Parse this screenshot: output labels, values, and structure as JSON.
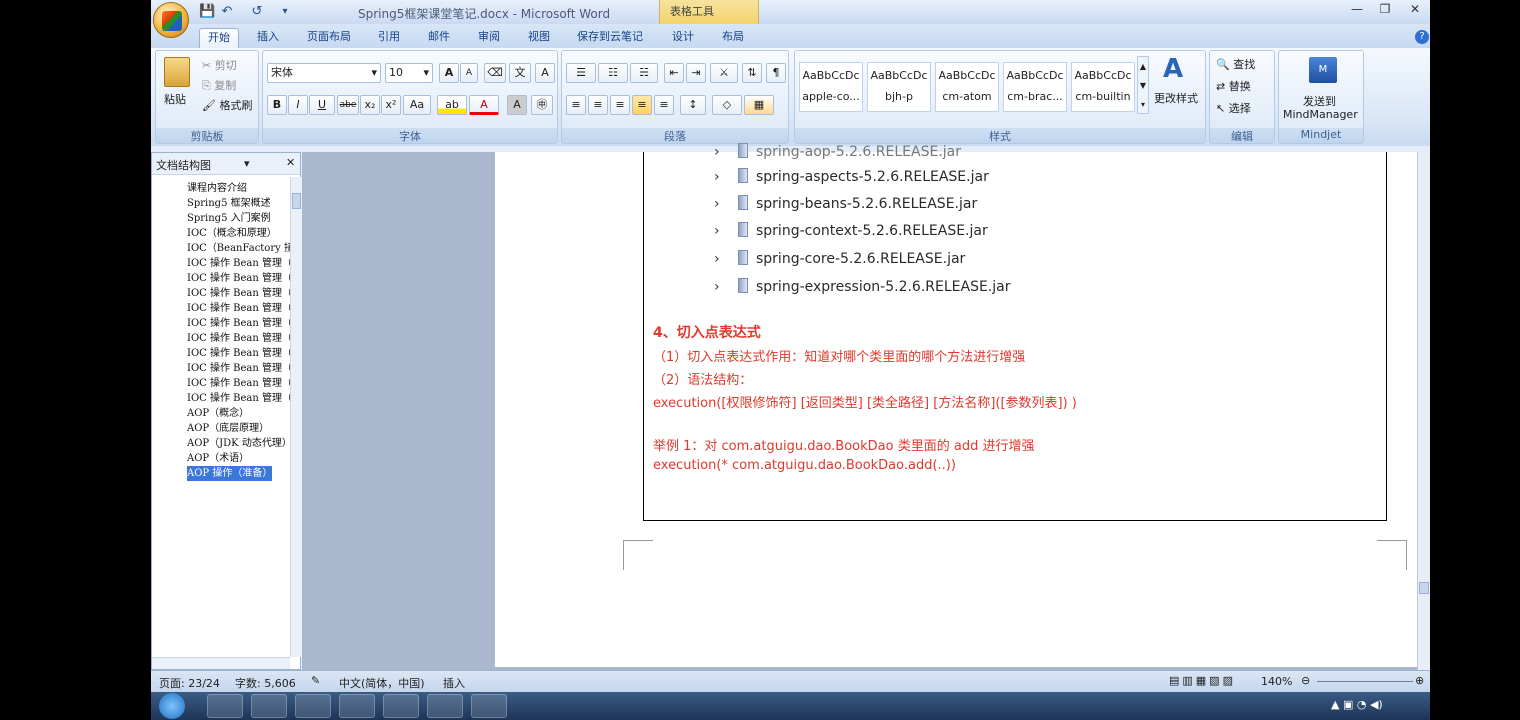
{
  "window": {
    "title": "Spring5框架课堂笔记.docx - Microsoft Word",
    "context_tab": "表格工具"
  },
  "tabs": [
    "开始",
    "插入",
    "页面布局",
    "引用",
    "邮件",
    "审阅",
    "视图",
    "保存到云笔记",
    "设计",
    "布局"
  ],
  "ribbon": {
    "clipboard": {
      "paste": "粘贴",
      "cut": "剪切",
      "copy": "复制",
      "format_painter": "格式刷",
      "label": "剪贴板"
    },
    "font": {
      "name": "宋体",
      "size": "10",
      "label": "字体"
    },
    "paragraph": {
      "label": "段落"
    },
    "styles": {
      "label": "样式",
      "items": [
        {
          "preview": "AaBbCcDc",
          "name": "apple-co..."
        },
        {
          "preview": "AaBbCcDc",
          "name": "bjh-p"
        },
        {
          "preview": "AaBbCcDc",
          "name": "cm-atom"
        },
        {
          "preview": "AaBbCcDc",
          "name": "cm-brac..."
        },
        {
          "preview": "AaBbCcDc",
          "name": "cm-builtin"
        }
      ],
      "change": "更改样式"
    },
    "editing": {
      "find": "查找",
      "replace": "替换",
      "select": "选择",
      "label": "编辑"
    },
    "mindjet": {
      "send_line1": "发送到",
      "send_line2": "MindManager",
      "label": "Mindjet"
    }
  },
  "docmap": {
    "title": "文档结构图",
    "items": [
      "课程内容介绍",
      "Spring5 框架概述",
      "Spring5 入门案例",
      "IOC（概念和原理）",
      "IOC（BeanFactory 接",
      "IOC 操作 Bean 管理（",
      "IOC 操作 Bean 管理（",
      "IOC 操作 Bean 管理（",
      "IOC 操作 Bean 管理（",
      "IOC 操作 Bean 管理（",
      "IOC 操作 Bean 管理（",
      "IOC 操作 Bean 管理（",
      "IOC 操作 Bean 管理（",
      "IOC 操作 Bean 管理（",
      "IOC 操作 Bean 管理（",
      "AOP（概念）",
      "AOP（底层原理）",
      "AOP（JDK 动态代理）",
      "AOP（术语）",
      "AOP 操作（准备）"
    ],
    "selected_index": 19
  },
  "document": {
    "partial_jar": "spring-aop-5.2.6.RELEASE.jar",
    "jars": [
      "spring-aspects-5.2.6.RELEASE.jar",
      "spring-beans-5.2.6.RELEASE.jar",
      "spring-context-5.2.6.RELEASE.jar",
      "spring-core-5.2.6.RELEASE.jar",
      "spring-expression-5.2.6.RELEASE.jar"
    ],
    "heading": "4、切入点表达式",
    "point1": "（1）切入点表达式作用：知道对哪个类里面的哪个方法进行增强",
    "point2": "（2）语法结构：",
    "syntax": "execution([权限修饰符] [返回类型] [类全路径] [方法名称]([参数列表]) )",
    "example_label": "举例 1：对 com.atguigu.dao.BookDao 类里面的 add 进行增强",
    "example_code": "execution(* com.atguigu.dao.BookDao.add(..))"
  },
  "statusbar": {
    "page": "页面: 23/24",
    "words": "字数: 5,606",
    "language": "中文(简体，中国)",
    "mode": "插入",
    "zoom": "140%"
  },
  "taskbar": {
    "time": ""
  }
}
